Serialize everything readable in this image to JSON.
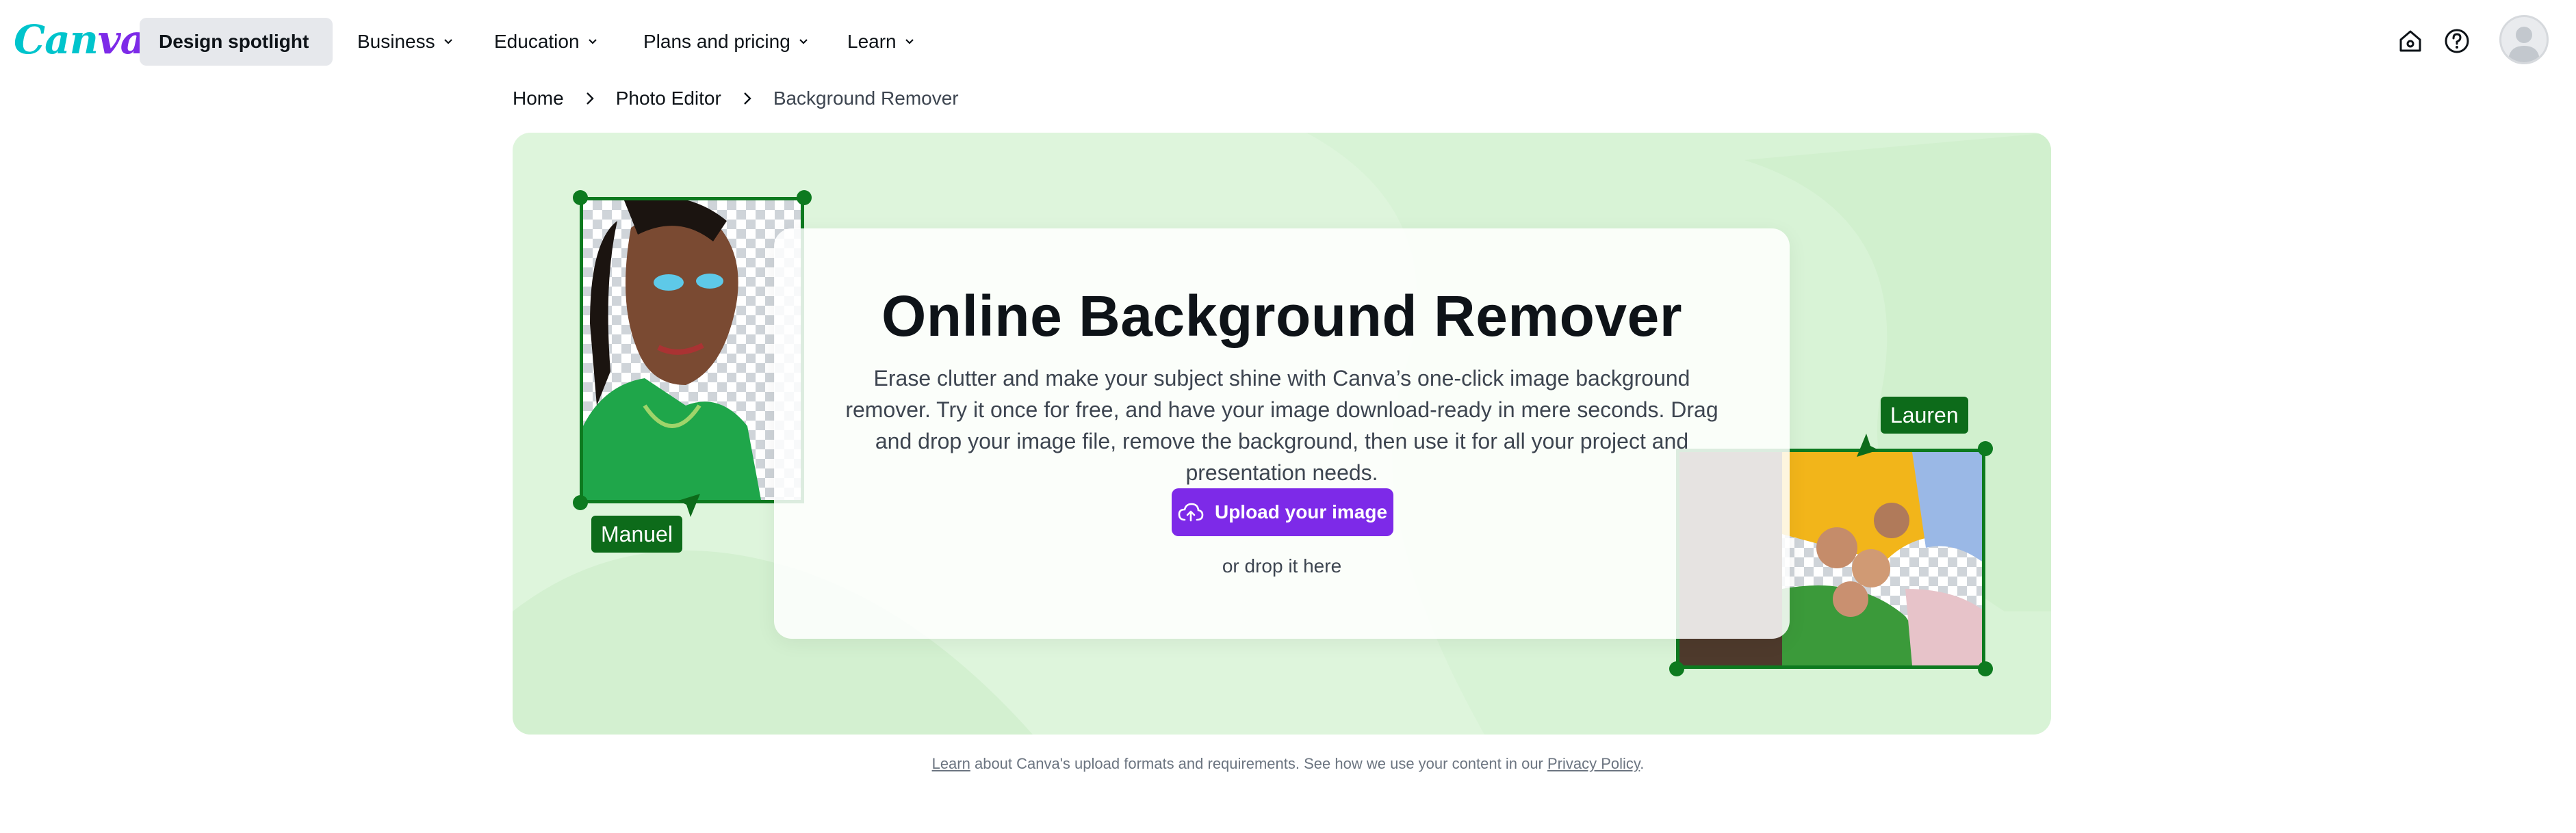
{
  "brand": {
    "logo_text_a": "Can",
    "logo_text_b": "va",
    "accent": "#7d2ae8",
    "hero_bg": "#def5dc",
    "frame_green": "#0d7a1f"
  },
  "nav": {
    "items": [
      {
        "label": "Design spotlight",
        "active": true
      },
      {
        "label": "Business"
      },
      {
        "label": "Education"
      },
      {
        "label": "Plans and pricing"
      },
      {
        "label": "Learn"
      }
    ],
    "icons": [
      "home-icon",
      "help-icon",
      "avatar"
    ]
  },
  "breadcrumb": {
    "items": [
      "Home",
      "Photo Editor",
      "Background Remover"
    ]
  },
  "hero": {
    "title": "Online Background Remover",
    "description": "Erase clutter and make your subject shine with Canva’s one-click image background remover. Try it once for free, and have your image download-ready in mere seconds. Drag and drop your image file, remove the background, then use it for all your project and presentation needs.",
    "upload_label": "Upload your image",
    "drop_text": "or drop it here",
    "tags": {
      "left": "Manuel",
      "right": "Lauren"
    }
  },
  "footnote": {
    "learn_link": "Learn",
    "middle": " about Canva's upload formats and requirements. See how we use your content in our ",
    "privacy_link": "Privacy Policy",
    "end": "."
  }
}
